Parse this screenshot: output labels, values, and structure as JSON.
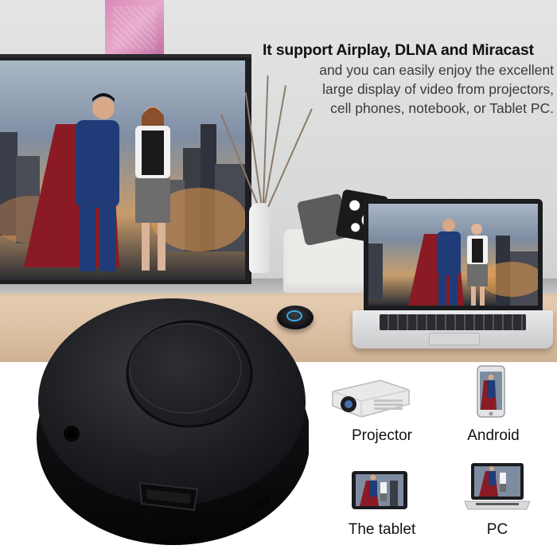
{
  "headline": "It support Airplay, DLNA and Miracast",
  "description_lines": [
    "and you can easily enjoy the excellent",
    "large display of video from projectors,",
    "cell phones, notebook, or Tablet PC."
  ],
  "devices": [
    {
      "label": "Projector",
      "icon": "projector-icon"
    },
    {
      "label": "Android",
      "icon": "android-phone-icon"
    },
    {
      "label": "The tablet",
      "icon": "tablet-icon"
    },
    {
      "label": "PC",
      "icon": "laptop-icon"
    }
  ],
  "colors": {
    "dongle_body": "#1c1d21",
    "dongle_ring": "#3aa7e8",
    "floor": "#dcc0a3",
    "text_dark": "#111111"
  }
}
